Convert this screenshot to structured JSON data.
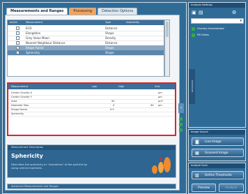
{
  "tabs": [
    {
      "label": "Measurements and Ranges"
    },
    {
      "label": "Processing"
    },
    {
      "label": "Detection Options"
    }
  ],
  "measure_table": {
    "headers": [
      "Active",
      "Measurement",
      "Type",
      "Availability"
    ],
    "rows": [
      {
        "name": "ECD",
        "type": "Distance",
        "checked": false
      },
      {
        "name": "Elongation",
        "type": "Shape",
        "checked": false
      },
      {
        "name": "Grey Value Mean",
        "type": "Density",
        "checked": false
      },
      {
        "name": "Nearest Neighbour Distance",
        "type": "Distance",
        "checked": false
      },
      {
        "name": "Shape Factor",
        "type": "Shape",
        "checked": true
      },
      {
        "name": "Sphericity",
        "type": "Shape",
        "checked": true
      }
    ]
  },
  "range_table": {
    "headers": [
      "Measurement",
      "Low",
      "High",
      "Unit"
    ],
    "rows": [
      {
        "name": "Center Gravity X",
        "low": "",
        "high": "",
        "unit": "µm"
      },
      {
        "name": "Center Gravity Y",
        "low": "",
        "high": "",
        "unit": "µm"
      },
      {
        "name": "Area",
        "low": "50",
        "high": "",
        "unit": "µm²"
      },
      {
        "name": "Diameter Max",
        "low": "4",
        "high": "30",
        "unit": "µm"
      },
      {
        "name": "Shape Factor",
        "low": "0.5",
        "high": "",
        "unit": ""
      },
      {
        "name": "Sphericity",
        "low": "",
        "high": "",
        "unit": ""
      }
    ]
  },
  "description": {
    "header": "Measurement Description",
    "title": "Sphericity",
    "body": "Describes the sphericity or \"roundness\" of the particle by using central moments."
  },
  "advanced_label": "Advanced Measurements and Ranges",
  "right_panel": {
    "settings_header": "Analysis Settings",
    "option1": "Overlay thresholded",
    "option2": "Fill Holes",
    "side_label": "Advanced",
    "image_source_header": "Image Source",
    "live_image": "Live Image",
    "scanned_image": "Scanned Image",
    "analyze_header": "Analyze Scan",
    "define_threshold": "Define Thresholds",
    "preview": "Preview",
    "analyze": "Analyze"
  },
  "colors": {
    "accent": "#d9262b",
    "header": "#3d6f99",
    "tab_highlight": "#f3a35b"
  }
}
